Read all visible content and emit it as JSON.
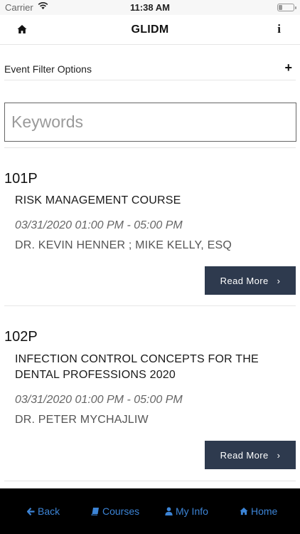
{
  "status": {
    "carrier": "Carrier",
    "time": "11:38 AM"
  },
  "nav": {
    "title": "GLIDM",
    "info_glyph": "i",
    "home_icon": "home-icon"
  },
  "filter": {
    "label": "Event Filter Options",
    "toggle": "+"
  },
  "search": {
    "placeholder": "Keywords",
    "value": ""
  },
  "events": [
    {
      "code": "101P",
      "name": "RISK MANAGEMENT COURSE",
      "datetime": "03/31/2020 01:00 PM - 05:00 PM",
      "speakers": "DR. KEVIN HENNER ; MIKE KELLY, ESQ",
      "button": "Read More"
    },
    {
      "code": "102P",
      "name": "INFECTION CONTROL CONCEPTS FOR THE DENTAL PROFESSIONS 2020",
      "datetime": "03/31/2020 01:00 PM - 05:00 PM",
      "speakers": "DR. PETER MYCHAJLIW",
      "button": "Read More"
    }
  ],
  "tabbar": {
    "back": "Back",
    "courses": "Courses",
    "myinfo": "My Info",
    "home": "Home"
  },
  "colors": {
    "accent": "#3c84d6",
    "button": "#2e3a4e",
    "tabbar": "#000000"
  }
}
